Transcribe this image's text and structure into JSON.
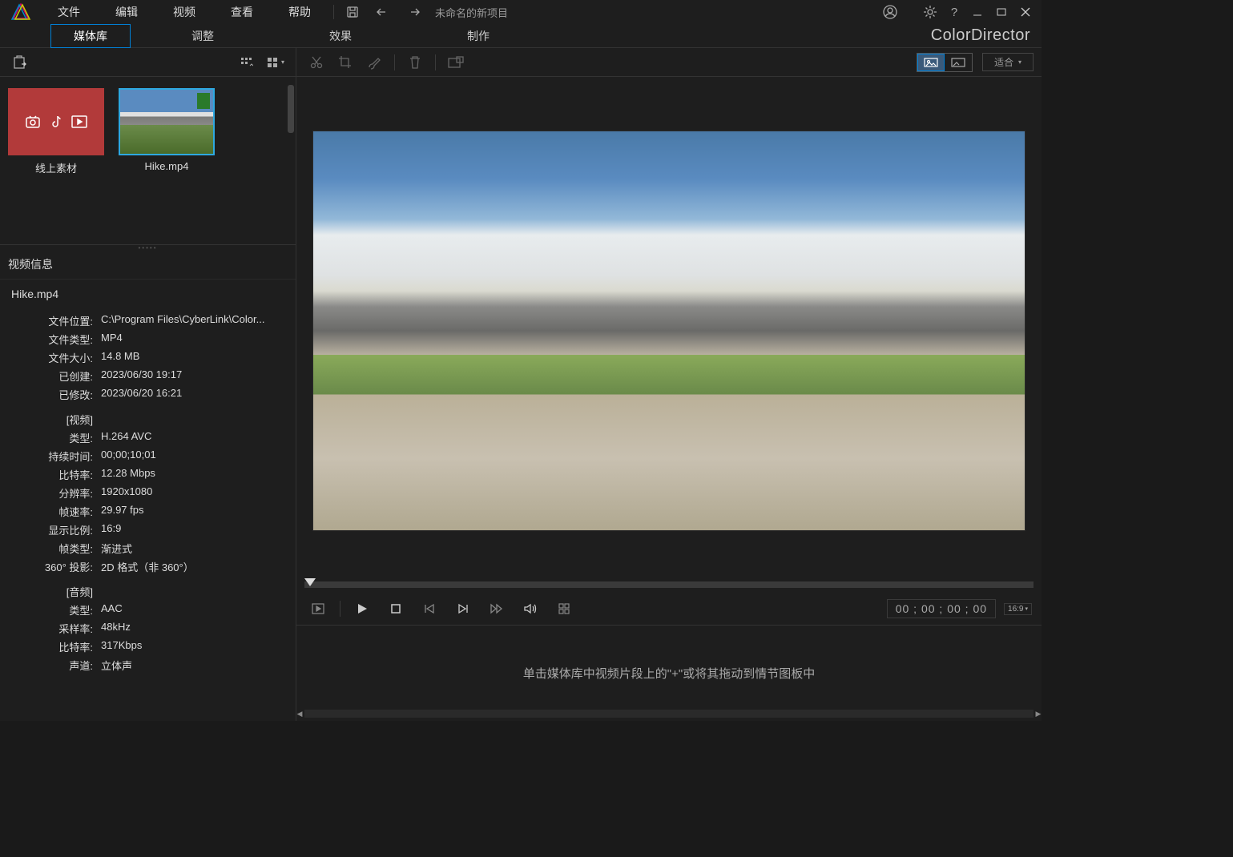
{
  "titlebar": {
    "project_name": "未命名的新项目",
    "menus": [
      "文件",
      "编辑",
      "视频",
      "查看",
      "帮助"
    ]
  },
  "brand": "ColorDirector",
  "module_tabs": [
    "媒体库",
    "调整",
    "效果",
    "制作"
  ],
  "library": {
    "items": [
      {
        "label": "线上素材"
      },
      {
        "label": "Hike.mp4"
      }
    ]
  },
  "info": {
    "header": "视频信息",
    "filename": "Hike.mp4",
    "rows": {
      "file_location_label": "文件位置:",
      "file_location": "C:\\Program Files\\CyberLink\\Color...",
      "file_type_label": "文件类型:",
      "file_type": "MP4",
      "file_size_label": "文件大小:",
      "file_size": "14.8 MB",
      "created_label": "已创建:",
      "created": "2023/06/30 19:17",
      "modified_label": "已修改:",
      "modified": "2023/06/20 16:21"
    },
    "video_section": "[视频]",
    "video": {
      "type_label": "类型:",
      "type": "H.264 AVC",
      "duration_label": "持续时间:",
      "duration": "00;00;10;01",
      "bitrate_label": "比特率:",
      "bitrate": "12.28 Mbps",
      "resolution_label": "分辨率:",
      "resolution": "1920x1080",
      "framerate_label": "帧速率:",
      "framerate": "29.97 fps",
      "aspect_label": "显示比例:",
      "aspect": "16:9",
      "frametype_label": "帧类型:",
      "frametype": "渐进式",
      "proj360_label": "360° 投影:",
      "proj360": "2D 格式（非 360°）"
    },
    "audio_section": "[音频]",
    "audio": {
      "type_label": "类型:",
      "type": "AAC",
      "samplerate_label": "采样率:",
      "samplerate": "48kHz",
      "bitrate_label": "比特率:",
      "bitrate": "317Kbps",
      "channels_label": "声道:",
      "channels": "立体声"
    }
  },
  "right_toolbar": {
    "fit_label": "适合"
  },
  "playback": {
    "timecode": "00 ; 00 ; 00 ; 00",
    "aspect_badge": "16:9"
  },
  "storyboard": {
    "hint": "单击媒体库中视频片段上的\"+\"或将其拖动到情节图板中"
  }
}
